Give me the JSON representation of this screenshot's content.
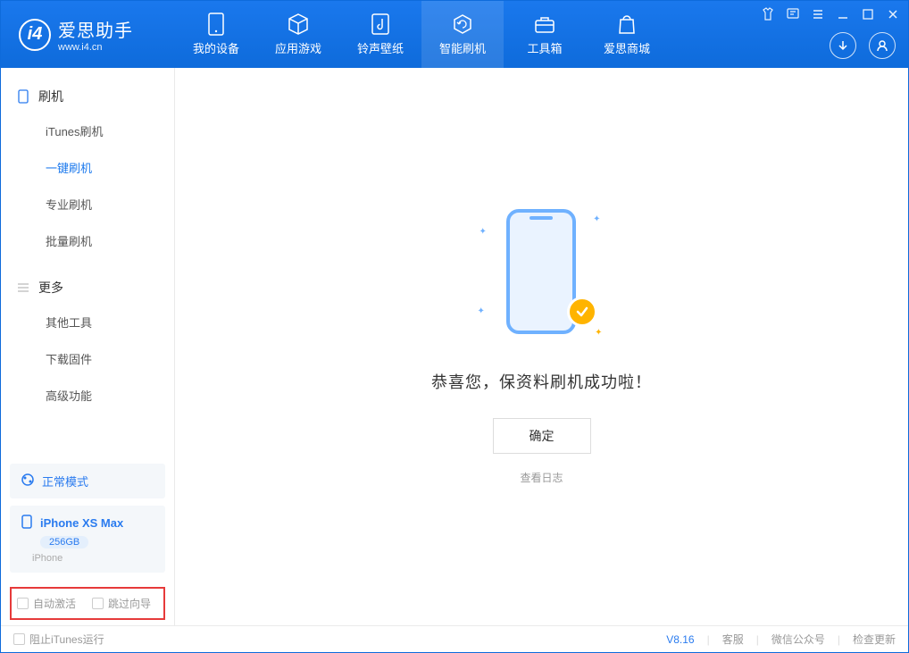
{
  "app": {
    "name": "爱思助手",
    "url": "www.i4.cn"
  },
  "nav": {
    "tabs": [
      {
        "label": "我的设备",
        "icon": "device"
      },
      {
        "label": "应用游戏",
        "icon": "cube"
      },
      {
        "label": "铃声壁纸",
        "icon": "music"
      },
      {
        "label": "智能刷机",
        "icon": "refresh",
        "active": true
      },
      {
        "label": "工具箱",
        "icon": "toolbox"
      },
      {
        "label": "爱思商城",
        "icon": "bag"
      }
    ]
  },
  "sidebar": {
    "section1": {
      "title": "刷机"
    },
    "items1": [
      {
        "label": "iTunes刷机"
      },
      {
        "label": "一键刷机",
        "active": true
      },
      {
        "label": "专业刷机"
      },
      {
        "label": "批量刷机"
      }
    ],
    "section2": {
      "title": "更多"
    },
    "items2": [
      {
        "label": "其他工具"
      },
      {
        "label": "下载固件"
      },
      {
        "label": "高级功能"
      }
    ],
    "mode": {
      "label": "正常模式"
    },
    "device": {
      "name": "iPhone XS Max",
      "storage": "256GB",
      "type": "iPhone"
    },
    "checks": {
      "auto_activate": "自动激活",
      "skip_wizard": "跳过向导"
    }
  },
  "main": {
    "success_msg": "恭喜您，保资料刷机成功啦！",
    "ok_btn": "确定",
    "view_log": "查看日志"
  },
  "footer": {
    "block_itunes": "阻止iTunes运行",
    "version": "V8.16",
    "links": {
      "support": "客服",
      "wechat": "微信公众号",
      "update": "检查更新"
    }
  }
}
